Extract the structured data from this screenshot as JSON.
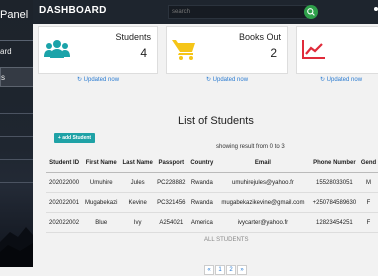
{
  "sidebar": {
    "title": "Panel",
    "items": [
      {
        "label": "ard"
      },
      {
        "label": "s"
      }
    ]
  },
  "topbar": {
    "title": "DASHBOARD",
    "search_placeholder": "search"
  },
  "cards": [
    {
      "label": "Students",
      "value": "4",
      "updated": "Updated now",
      "icon": "users-icon",
      "icon_color": "#1aa3a9"
    },
    {
      "label": "Books Out",
      "value": "2",
      "updated": "Updated now",
      "icon": "cart-icon",
      "icon_color": "#f5c518"
    },
    {
      "label": "",
      "value": "",
      "updated": "Updated now",
      "icon": "chart-icon",
      "icon_color": "#e02b3a"
    }
  ],
  "students": {
    "heading": "List of Students",
    "add_button": "+ add Student",
    "showing": "showing result from 0 to 3",
    "columns": [
      "Student ID",
      "First Name",
      "Last Name",
      "Passport",
      "Country",
      "Email",
      "Phone Number",
      "Gend"
    ],
    "rows": [
      [
        "202022000",
        "Umuhire",
        "Jules",
        "PC228882",
        "Rwanda",
        "umuhirejules@yahoo.fr",
        "15528033051",
        "M"
      ],
      [
        "202022001",
        "Mugabekazi",
        "Kevine",
        "PC321456",
        "Rwanda",
        "mugabekazikevine@gmail.com",
        "+250784589630",
        "F"
      ],
      [
        "202022002",
        "Blue",
        "Ivy",
        "A254021",
        "America",
        "ivycarter@yahoo.fr",
        "12823454251",
        "F"
      ]
    ],
    "all_label": "ALL STUDENTS"
  },
  "pagination": {
    "prev": "«",
    "pages": [
      "1",
      "2"
    ],
    "next": "»"
  }
}
